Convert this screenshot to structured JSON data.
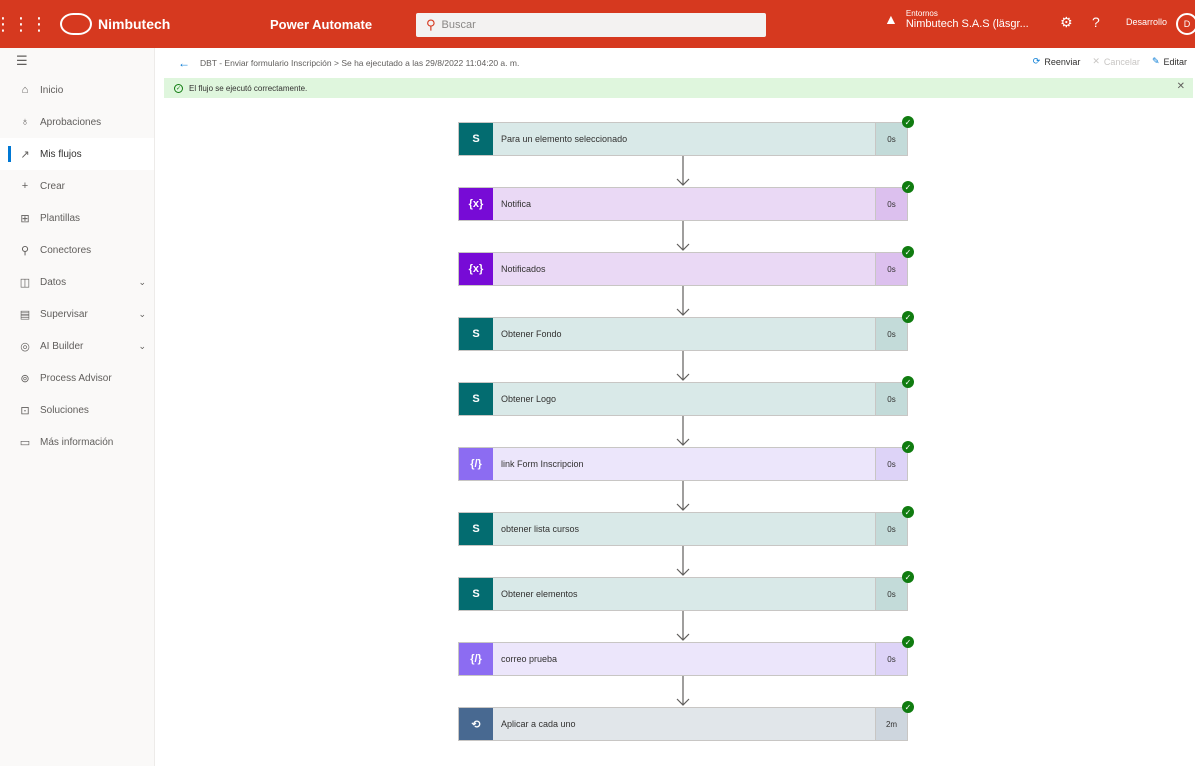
{
  "topbar": {
    "brand": "Nimbutech",
    "app": "Power Automate",
    "search_placeholder": "Buscar",
    "env_label": "Entornos",
    "env_name": "Nimbutech S.A.S (läsgr...",
    "developer_label": "Desarrollo",
    "avatar_initials": "D"
  },
  "sidebar": {
    "items": [
      {
        "label": "Inicio",
        "icon": "home-icon",
        "glyph": "⌂"
      },
      {
        "label": "Aprobaciones",
        "icon": "approvals-icon",
        "glyph": "♁"
      },
      {
        "label": "Mis flujos",
        "icon": "flows-icon",
        "glyph": "↗"
      },
      {
        "label": "Crear",
        "icon": "plus-icon",
        "glyph": "+"
      },
      {
        "label": "Plantillas",
        "icon": "templates-icon",
        "glyph": "⊞"
      },
      {
        "label": "Conectores",
        "icon": "connectors-icon",
        "glyph": "⚲"
      },
      {
        "label": "Datos",
        "icon": "data-icon",
        "glyph": "◫"
      },
      {
        "label": "Supervisar",
        "icon": "monitor-icon",
        "glyph": "▤"
      },
      {
        "label": "AI Builder",
        "icon": "ai-builder-icon",
        "glyph": "◎"
      },
      {
        "label": "Process Advisor",
        "icon": "process-advisor-icon",
        "glyph": "⊚"
      },
      {
        "label": "Soluciones",
        "icon": "solutions-icon",
        "glyph": "⊡"
      },
      {
        "label": "Más información",
        "icon": "info-book-icon",
        "glyph": "▭"
      }
    ]
  },
  "cmdbar": {
    "breadcrumb": "DBT - Enviar formulario Inscripción > Se ha ejecutado a las 29/8/2022 11:04:20 a. m.",
    "resubmit": "Reenviar",
    "cancel": "Cancelar",
    "edit": "Editar"
  },
  "banner": {
    "message": "El flujo se ejecutó correctamente."
  },
  "steps": [
    {
      "title": "Para un elemento seleccionado",
      "duration": "0s",
      "type": "t-sp",
      "icon_label": "S",
      "icon": "sharepoint-icon"
    },
    {
      "title": "Notifica",
      "duration": "0s",
      "type": "t-var",
      "icon_label": "{x}",
      "icon": "variable-icon"
    },
    {
      "title": "Notificados",
      "duration": "0s",
      "type": "t-var",
      "icon_label": "{x}",
      "icon": "variable-icon"
    },
    {
      "title": "Obtener Fondo",
      "duration": "0s",
      "type": "t-sp",
      "icon_label": "S",
      "icon": "sharepoint-icon"
    },
    {
      "title": "Obtener Logo",
      "duration": "0s",
      "type": "t-sp",
      "icon_label": "S",
      "icon": "sharepoint-icon"
    },
    {
      "title": "link Form Inscripcion",
      "duration": "0s",
      "type": "t-cmp",
      "icon_label": "{/}",
      "icon": "compose-icon"
    },
    {
      "title": "obtener lista cursos",
      "duration": "0s",
      "type": "t-sp",
      "icon_label": "S",
      "icon": "sharepoint-icon"
    },
    {
      "title": "Obtener elementos",
      "duration": "0s",
      "type": "t-sp",
      "icon_label": "S",
      "icon": "sharepoint-icon"
    },
    {
      "title": "correo prueba",
      "duration": "0s",
      "type": "t-cmp",
      "icon_label": "{/}",
      "icon": "compose-icon"
    },
    {
      "title": "Aplicar a cada uno",
      "duration": "2m",
      "type": "t-loop",
      "icon_label": "⟲",
      "icon": "loop-icon"
    }
  ]
}
